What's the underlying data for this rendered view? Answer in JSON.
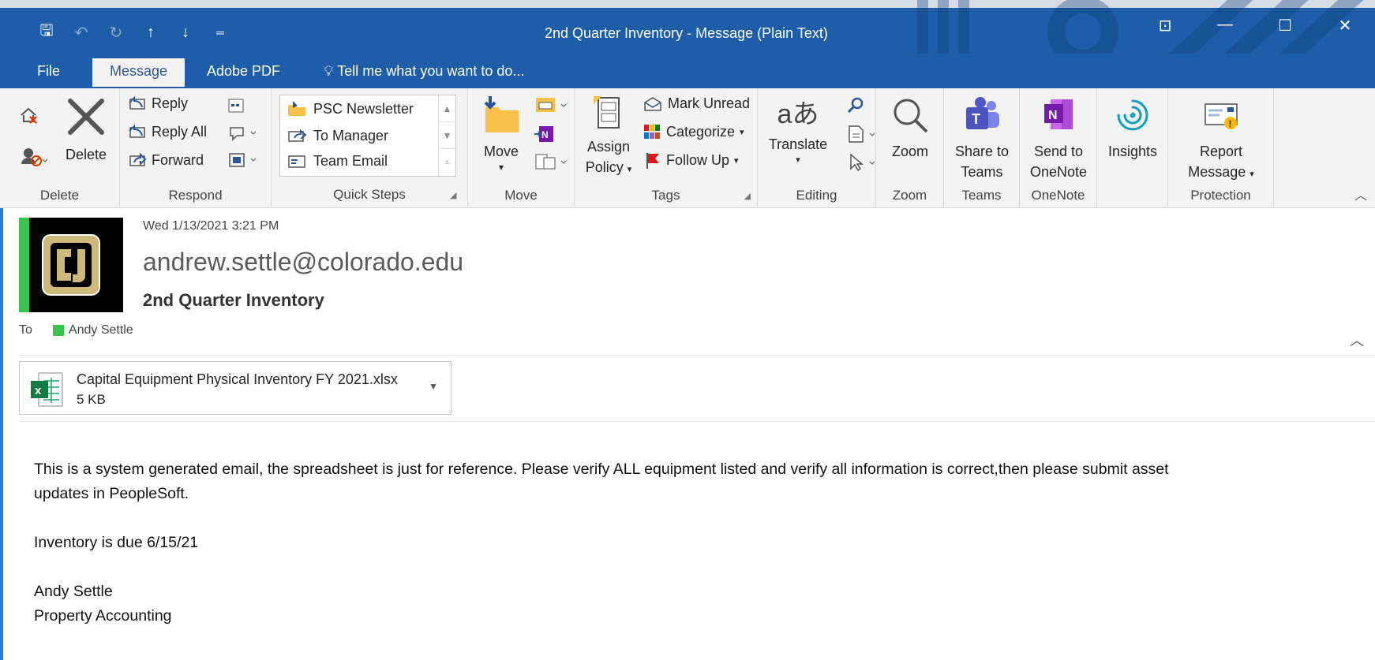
{
  "window": {
    "title": "2nd Quarter Inventory - Message (Plain Text)",
    "controls": [
      "restore-ribbon",
      "minimize",
      "maximize",
      "close"
    ]
  },
  "qat": [
    "save",
    "undo",
    "redo",
    "up",
    "down",
    "customize"
  ],
  "tabs": {
    "file": "File",
    "message": "Message",
    "adobe": "Adobe PDF",
    "tellme": "Tell me what you want to do..."
  },
  "ribbon": {
    "delete_group": {
      "label": "Delete",
      "delete": "Delete"
    },
    "respond_group": {
      "label": "Respond",
      "reply": "Reply",
      "reply_all": "Reply All",
      "forward": "Forward"
    },
    "quicksteps_group": {
      "label": "Quick Steps",
      "items": [
        "PSC Newsletter",
        "To Manager",
        "Team Email"
      ]
    },
    "move_group": {
      "label": "Move",
      "move": "Move"
    },
    "tags_group": {
      "label": "Tags",
      "assign": "Assign",
      "policy": "Policy",
      "mark_unread": "Mark Unread",
      "categorize": "Categorize",
      "follow_up": "Follow Up"
    },
    "editing_group": {
      "label": "Editing",
      "translate": "Translate"
    },
    "zoom_group": {
      "label": "Zoom",
      "zoom": "Zoom"
    },
    "teams_group": {
      "label": "Teams",
      "share1": "Share to",
      "share2": "Teams"
    },
    "onenote_group": {
      "label": "OneNote",
      "send1": "Send to",
      "send2": "OneNote"
    },
    "insights": {
      "label": "Insights"
    },
    "protection_group": {
      "label": "Protection",
      "report1": "Report",
      "report2": "Message"
    }
  },
  "message": {
    "sent": "Wed 1/13/2021 3:21 PM",
    "sender": "andrew.settle@colorado.edu",
    "subject": "2nd Quarter Inventory",
    "to_label": "To",
    "to_name": "Andy Settle"
  },
  "attachment": {
    "name": "Capital Equipment Physical Inventory FY 2021.xlsx",
    "size": "5 KB"
  },
  "body": {
    "p1a": "This is a system generated email, the spreadsheet is just for reference. Please verify ALL equipment listed and verify all information is correct,then please submit asset",
    "p1b": "updates in PeopleSoft.",
    "p2": "Inventory is due 6/15/21",
    "sig1": "Andy Settle",
    "sig2": "Property Accounting"
  },
  "colors": {
    "titlebar": "#1e5ea8",
    "ribbon": "#f3f3f3",
    "accent_green": "#3cc24f"
  }
}
